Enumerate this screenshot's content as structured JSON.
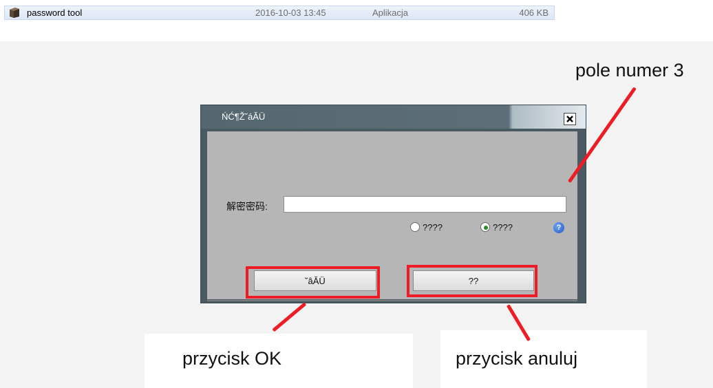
{
  "file_row": {
    "name": "password tool",
    "date": "2016-10-03 13:45",
    "type": "Aplikacja",
    "size": "406 KB"
  },
  "dialog": {
    "title": "ŃĆ¶Ž˘áĂÜ",
    "close_label": "×",
    "password_label": "解密密码:",
    "password_value": "",
    "radio_1_label": "????",
    "radio_2_label": "????",
    "radio_selected": 2,
    "help_label": "?",
    "ok_label": "˘âĂÜ",
    "cancel_label": "??"
  },
  "annotations": {
    "field_note": "pole numer 3",
    "ok_note": "przycisk OK",
    "cancel_note": "przycisk anuluj"
  },
  "colors": {
    "annotation_red": "#ee1c24",
    "title_bar": "#55666f",
    "client_gray": "#b6b6b6"
  }
}
